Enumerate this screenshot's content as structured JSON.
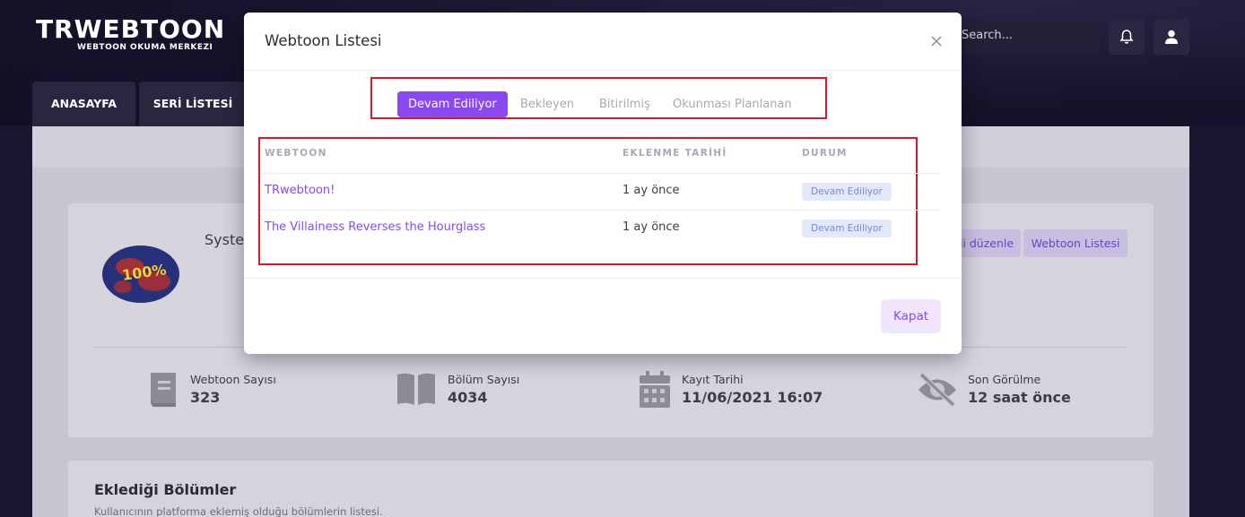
{
  "header": {
    "logo_main": "TRWEBTOON",
    "logo_sub": "WEBTOON OKUMA MERKEZI",
    "search_placeholder": "Search...",
    "nav": [
      {
        "label": "ANASAYFA"
      },
      {
        "label": "SERİ LİSTESİ"
      }
    ]
  },
  "profile": {
    "name_partial": "Syste",
    "buttons": [
      {
        "label": "li düzenle"
      },
      {
        "label": "Webtoon Listesi"
      }
    ],
    "stats": [
      {
        "label": "Webtoon Sayısı",
        "value": "323",
        "icon": "book-icon"
      },
      {
        "label": "Bölüm Sayısı",
        "value": "4034",
        "icon": "open-book-icon"
      },
      {
        "label": "Kayıt Tarihi",
        "value": "11/06/2021 16:07",
        "icon": "calendar-icon"
      },
      {
        "label": "Son Görülme",
        "value": "12 saat önce",
        "icon": "eye-slash-icon"
      }
    ]
  },
  "episodes": {
    "title": "Eklediği Bölümler",
    "description": "Kullanıcının platforma eklemiş olduğu bölümlerin listesi."
  },
  "modal": {
    "title": "Webtoon Listesi",
    "tabs": [
      {
        "label": "Devam Ediliyor",
        "active": true
      },
      {
        "label": "Bekleyen",
        "active": false
      },
      {
        "label": "Bitirilmiş",
        "active": false
      },
      {
        "label": "Okunması Planlanan",
        "active": false
      }
    ],
    "table": {
      "headers": [
        "WEBTOON",
        "EKLENME TARİHİ",
        "DURUM"
      ],
      "rows": [
        {
          "webtoon": "TRwebtoon!",
          "date": "1 ay önce",
          "status": "Devam Ediliyor"
        },
        {
          "webtoon": "The Villainess Reverses the Hourglass",
          "date": "1 ay önce",
          "status": "Devam Ediliyor"
        }
      ]
    },
    "close_label": "Kapat"
  },
  "colors": {
    "accent": "#8a48f0",
    "highlight_border": "#d7182a",
    "badge_bg": "#e3e9fb",
    "badge_text": "#6e8be0"
  }
}
